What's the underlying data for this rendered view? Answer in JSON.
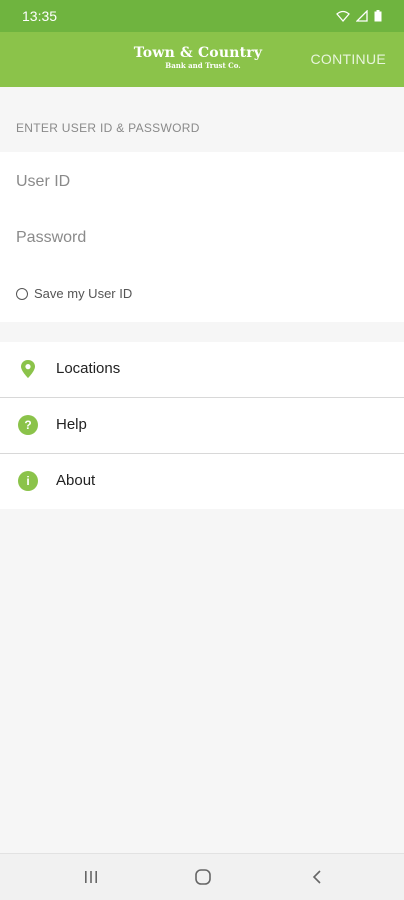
{
  "status_bar": {
    "time": "13:35",
    "icons": [
      "wifi-icon",
      "signal-icon",
      "battery-icon"
    ]
  },
  "app_bar": {
    "logo_title": "Town & Country",
    "logo_subtitle": "Bank and Trust Co.",
    "continue_label": "CONTINUE"
  },
  "login": {
    "section_header": "ENTER USER ID & PASSWORD",
    "userid_placeholder": "User ID",
    "password_placeholder": "Password",
    "save_label": "Save my User ID"
  },
  "menu": {
    "items": [
      {
        "label": "Locations",
        "icon": "location-pin-icon"
      },
      {
        "label": "Help",
        "icon": "help-icon"
      },
      {
        "label": "About",
        "icon": "info-icon"
      }
    ]
  },
  "nav": {
    "buttons": [
      "recent-apps-icon",
      "home-icon",
      "back-icon"
    ]
  },
  "colors": {
    "status_bar": "#6fb43f",
    "app_bar": "#8bc34a",
    "accent": "#8bc34a",
    "background": "#f6f6f6"
  }
}
